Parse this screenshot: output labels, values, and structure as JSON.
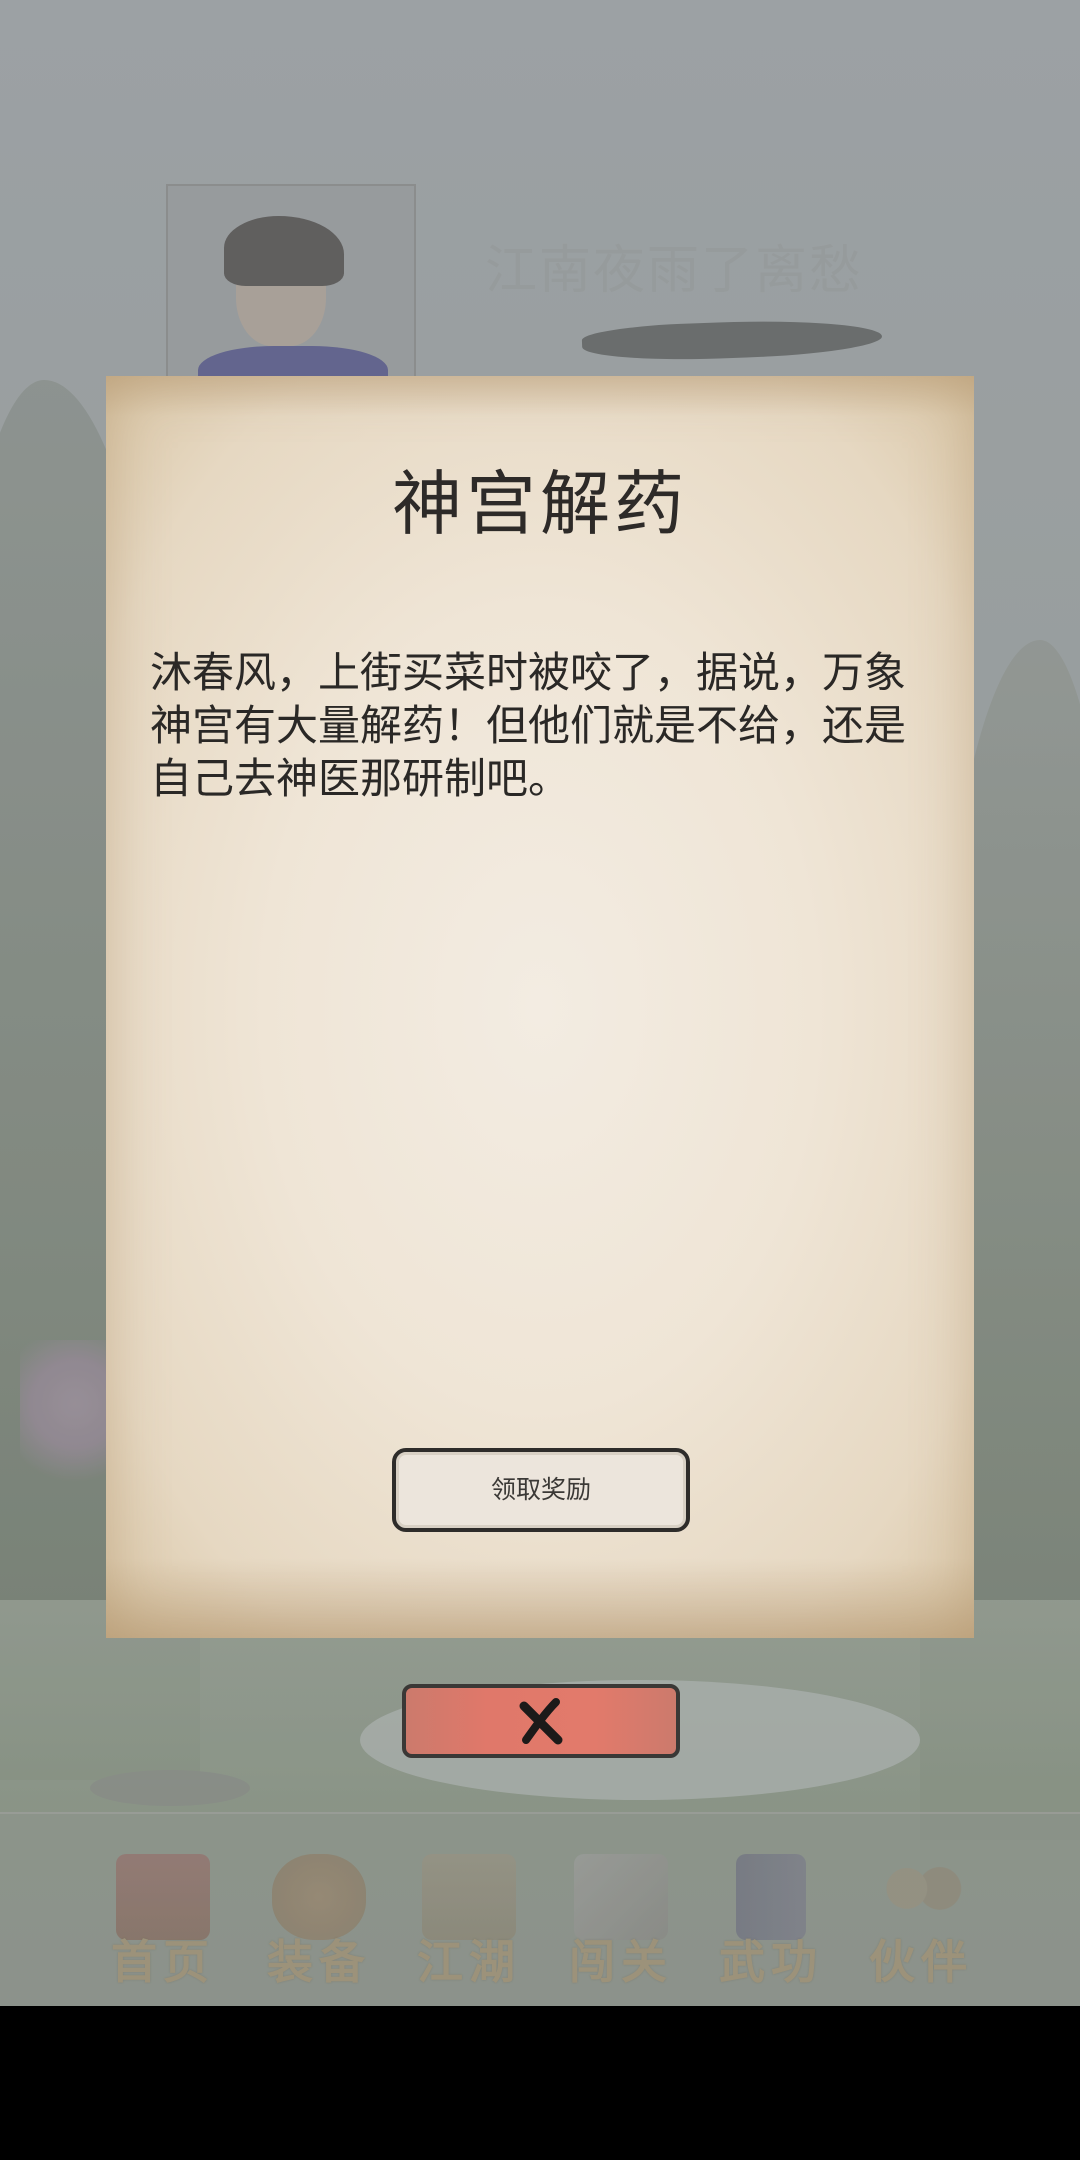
{
  "header": {
    "player_name": "江南夜雨了离愁"
  },
  "dialog": {
    "title": "神宫解药",
    "body": "沐春风，上街买菜时被咬了，据说，万象神宫有大量解药！但他们就是不给，还是自己去神医那研制吧。",
    "claim_button_label": "领取奖励",
    "close_icon": "close-x-icon"
  },
  "bottom_nav": {
    "items": [
      {
        "label": "首页",
        "icon": "home-pavilion-icon"
      },
      {
        "label": "装备",
        "icon": "equipment-jar-icon"
      },
      {
        "label": "江湖",
        "icon": "jianghu-scroll-icon"
      },
      {
        "label": "闯关",
        "icon": "crossed-swords-icon"
      },
      {
        "label": "武功",
        "icon": "martial-book-icon"
      },
      {
        "label": "伙伴",
        "icon": "companions-icon"
      }
    ]
  },
  "colors": {
    "parchment": "#efe5d6",
    "close_button": "#e27a6b",
    "title_text": "#2d2a28"
  }
}
